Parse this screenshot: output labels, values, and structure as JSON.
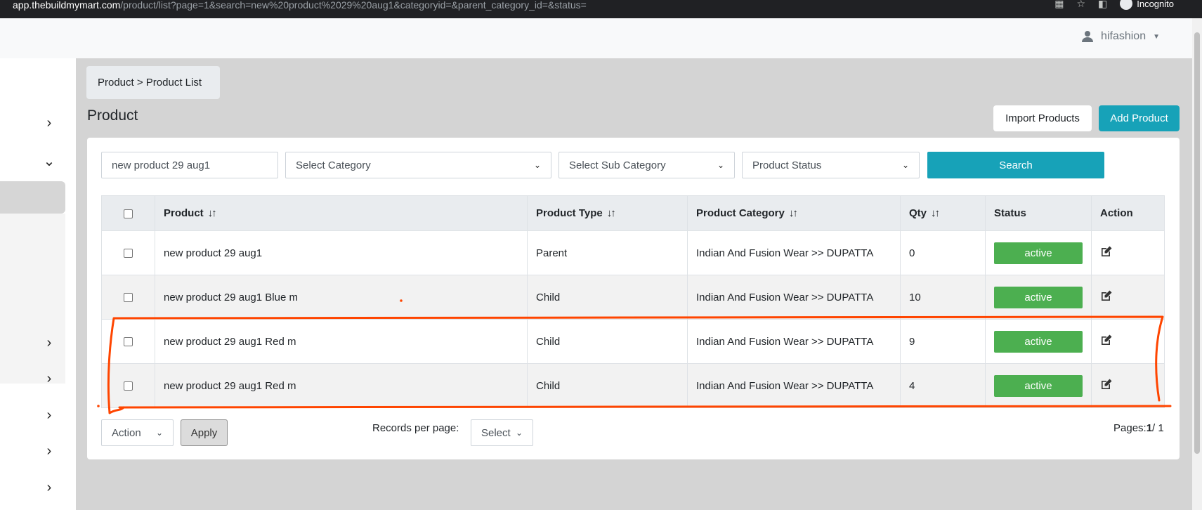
{
  "browser": {
    "url_host": "app.thebuildmymart.com",
    "url_path": "/product/list?page=1&search=new%20product%2029%20aug1&categoryid=&parent_category_id=&status=",
    "profile_label": "Incognito"
  },
  "header": {
    "username": "hifashion"
  },
  "breadcrumb": "Product > Product List",
  "page_title": "Product",
  "buttons": {
    "import": "Import Products",
    "add": "Add Product",
    "search": "Search",
    "apply": "Apply"
  },
  "filters": {
    "search_value": "new product 29 aug1",
    "category": "Select Category",
    "sub_category": "Select Sub Category",
    "status": "Product Status"
  },
  "table": {
    "columns": [
      "Product",
      "Product Type",
      "Product Category",
      "Qty",
      "Status",
      "Action"
    ],
    "rows": [
      {
        "product": "new product 29 aug1",
        "type": "Parent",
        "category": "Indian And Fusion Wear >> DUPATTA",
        "qty": "0",
        "status": "active"
      },
      {
        "product": "new product 29 aug1 Blue m",
        "type": "Child",
        "category": "Indian And Fusion Wear >> DUPATTA",
        "qty": "10",
        "status": "active"
      },
      {
        "product": "new product 29 aug1 Red m",
        "type": "Child",
        "category": "Indian And Fusion Wear >> DUPATTA",
        "qty": "9",
        "status": "active"
      },
      {
        "product": "new product 29 aug1 Red m",
        "type": "Child",
        "category": "Indian And Fusion Wear >> DUPATTA",
        "qty": "4",
        "status": "active"
      }
    ]
  },
  "footer": {
    "action_select": "Action",
    "records_label": "Records per page:",
    "records_select": "Select",
    "pages_label": "Pages:",
    "current_page": "1",
    "total_pages": "/ 1"
  },
  "colors": {
    "accent": "#17a2b8",
    "active_status": "#4caf50",
    "annotation": "#ff4500"
  }
}
